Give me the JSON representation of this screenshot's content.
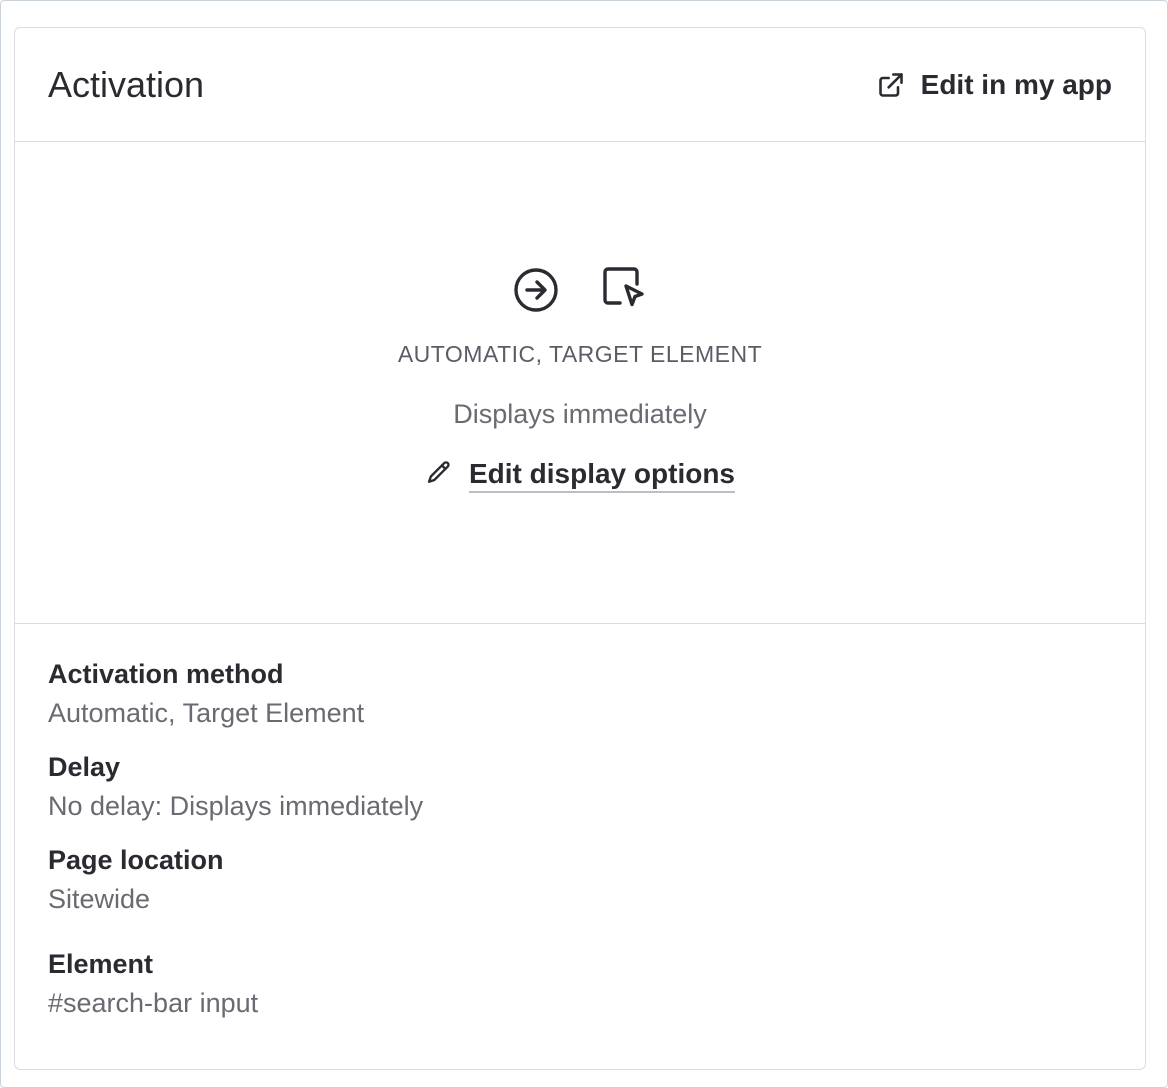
{
  "card": {
    "title": "Activation",
    "edit_app_label": "Edit in my app"
  },
  "summary": {
    "icons": [
      "arrow-right-circle-icon",
      "target-element-cursor-icon"
    ],
    "method_caption": "AUTOMATIC, TARGET ELEMENT",
    "delay_caption": "Displays immediately",
    "edit_options_label": "Edit display options"
  },
  "details": [
    {
      "label": "Activation method",
      "value": "Automatic, Target Element"
    },
    {
      "label": "Delay",
      "value": "No delay: Displays immediately"
    },
    {
      "label": "Page location",
      "value": "Sitewide"
    },
    {
      "label": "Element",
      "value": "#search-bar input"
    }
  ],
  "colors": {
    "text_primary": "#2a2a31",
    "text_secondary": "#6a6a72",
    "border": "#dcdcdf"
  }
}
